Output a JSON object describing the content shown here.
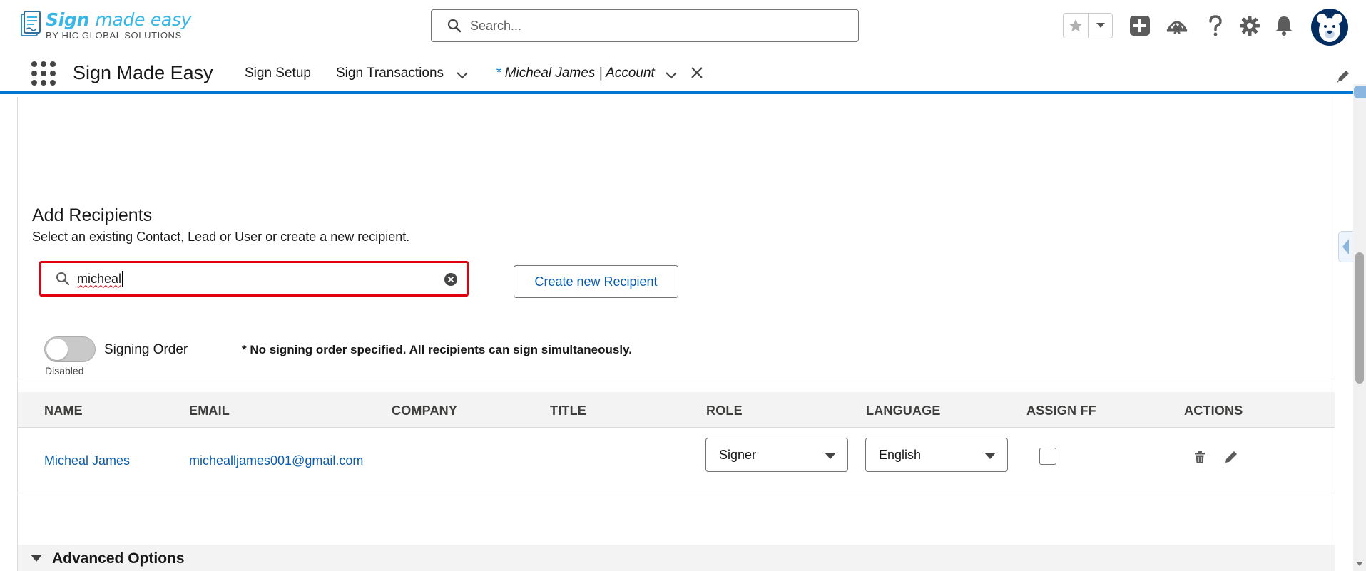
{
  "brand": {
    "logo_title_bold": "Sign",
    "logo_title_light": "made easy",
    "logo_subtitle": "BY HIC GLOBAL SOLUTIONS"
  },
  "global_search": {
    "placeholder": "Search..."
  },
  "header_icons": [
    "star-icon",
    "chevron-down-icon",
    "add-icon",
    "trailhead-icon",
    "help-icon",
    "setup-gear-icon",
    "bell-icon",
    "avatar-bear-icon"
  ],
  "app_nav": {
    "app_name": "Sign Made Easy",
    "items": [
      "Sign Setup",
      "Sign Transactions"
    ],
    "active_tab": {
      "dirty_marker": "*",
      "label": "Micheal James | Account"
    }
  },
  "recipients": {
    "title": "Add Recipients",
    "description": "Select an existing Contact, Lead or User or create a new recipient.",
    "search_value": "micheal",
    "create_button": "Create new Recipient",
    "signing_order": {
      "label": "Signing Order",
      "status": "Disabled",
      "enabled": false
    },
    "note": "* No signing order specified. All recipients can sign simultaneously.",
    "columns": [
      "NAME",
      "EMAIL",
      "COMPANY",
      "TITLE",
      "ROLE",
      "LANGUAGE",
      "ASSIGN FF",
      "ACTIONS"
    ],
    "rows": [
      {
        "name": "Micheal James",
        "email": "michealljames001@gmail.com",
        "company": "",
        "title": "",
        "role": "Signer",
        "language": "English",
        "assign_ff": false
      }
    ]
  },
  "advanced_options": {
    "label": "Advanced Options",
    "expanded": true
  },
  "colors": {
    "brand_blue": "#0176d3",
    "link": "#0b5cab",
    "error_red": "#e0000f",
    "logo_cyan": "#38b6e8"
  }
}
